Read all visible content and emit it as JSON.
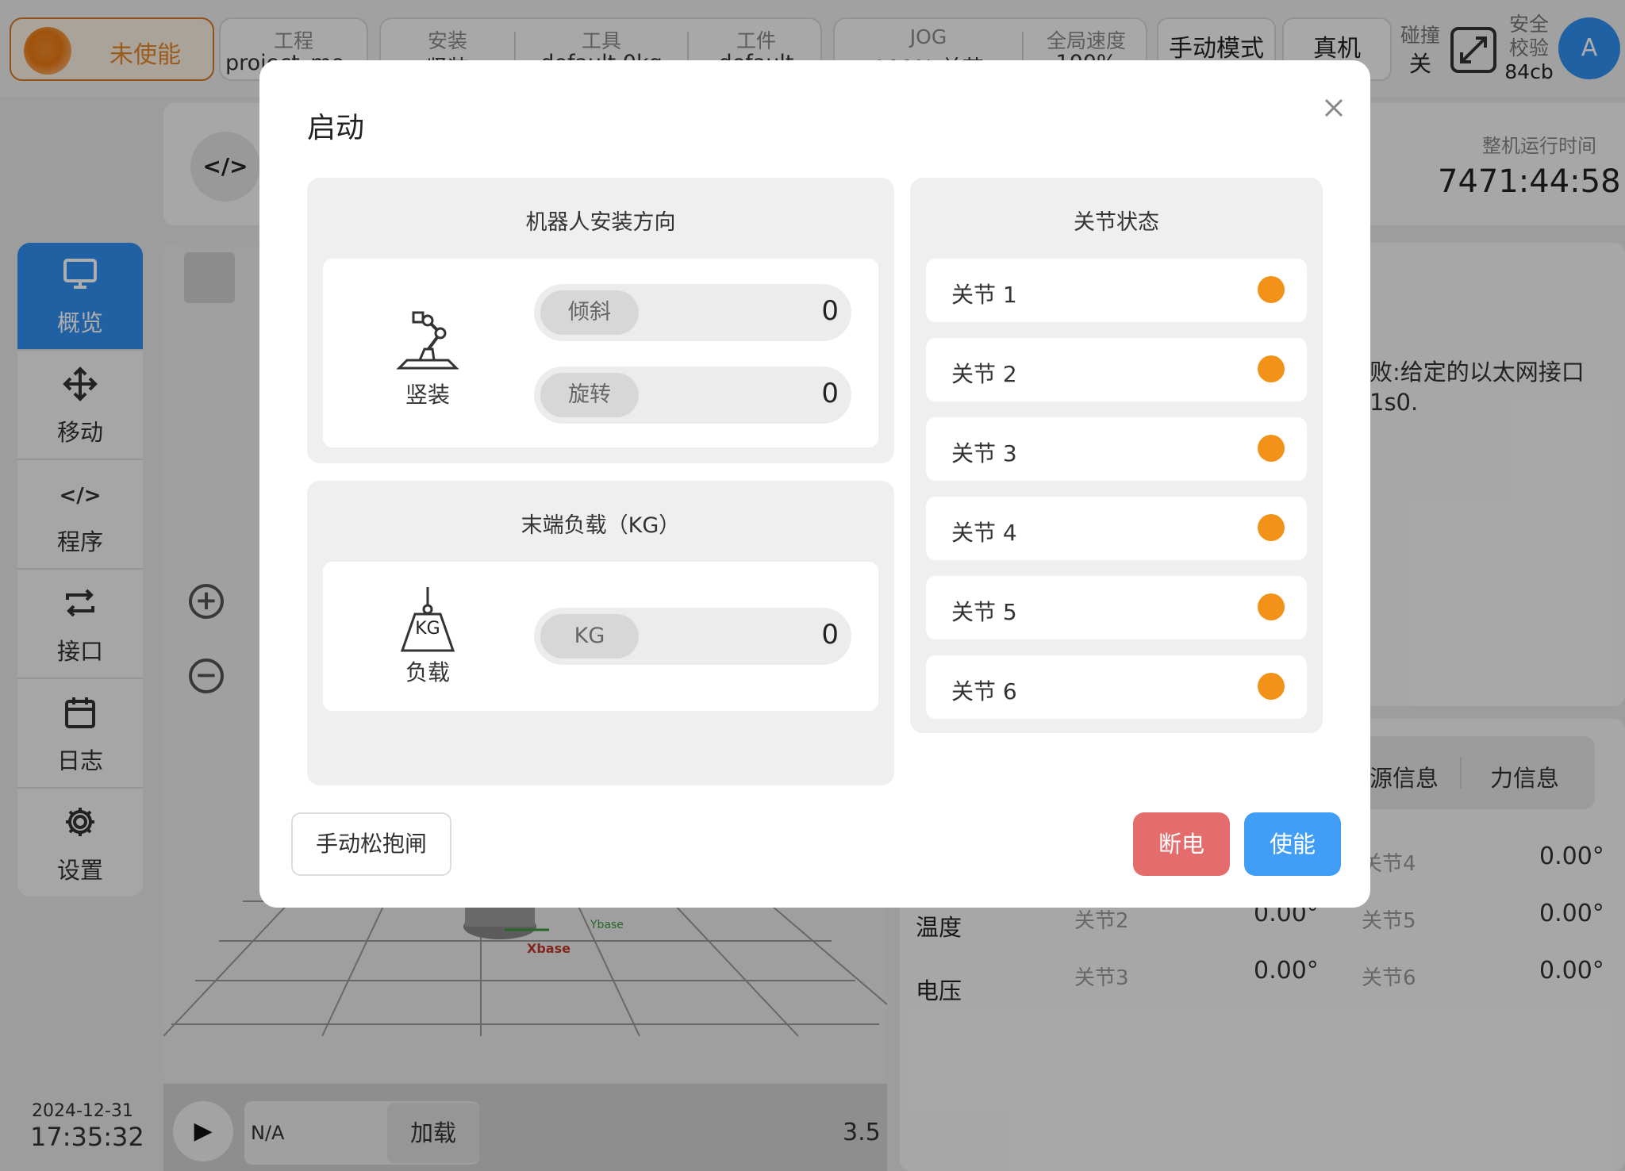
{
  "topbar": {
    "enable_status": "未使能",
    "project_caption": "工程",
    "project_value": "project_mo",
    "install_caption": "安装",
    "install_value": "竖装",
    "tool_caption": "工具",
    "tool_value": "default 0kg",
    "workpiece_caption": "工件",
    "workpiece_value": "default",
    "jog_caption": "JOG",
    "jog_value": "100% 关节",
    "global_speed_caption": "全局速度",
    "global_speed_value": "100%",
    "mode_button": "手动模式",
    "real_machine_button": "真机",
    "collision_caption": "碰撞",
    "collision_value": "关",
    "safety_caption_1": "安全",
    "safety_caption_2": "校验",
    "safety_value": "84cb",
    "avatar_letter": "A"
  },
  "sidebar": {
    "items": [
      {
        "label": "概览",
        "icon": "monitor-icon"
      },
      {
        "label": "移动",
        "icon": "move-arrows-icon"
      },
      {
        "label": "程序",
        "icon": "code-icon"
      },
      {
        "label": "接口",
        "icon": "swap-arrows-icon"
      },
      {
        "label": "日志",
        "icon": "calendar-icon"
      },
      {
        "label": "设置",
        "icon": "gear-icon"
      }
    ],
    "date": "2024-12-31",
    "time": "17:35:32"
  },
  "main": {
    "code_label": "</>",
    "runtime_caption": "整机运行时间",
    "runtime_value": "7471:44:58",
    "error_line1": "败:给定的以太网接口",
    "error_line2": "1s0.",
    "tab_source": "源信息",
    "tab_force": "力信息",
    "row_temperature": "温度",
    "row_voltage": "电压",
    "joints": [
      {
        "label": "关节2",
        "value": "0.00°"
      },
      {
        "label": "关节3",
        "value": "0.00°"
      },
      {
        "label": "关节4",
        "value": "0.00°"
      },
      {
        "label": "关节5",
        "value": "0.00°"
      },
      {
        "label": "关节6",
        "value": "0.00°"
      }
    ],
    "program_name": "N/A",
    "load_button": "加载",
    "speed_value": "3.5",
    "axis_x": "Xbase",
    "axis_y": "Ybase"
  },
  "modal": {
    "title": "启动",
    "mount_section_title": "机器人安装方向",
    "mount_type_label": "竖装",
    "tilt_label": "倾斜",
    "tilt_value": "0",
    "rotate_label": "旋转",
    "rotate_value": "0",
    "payload_section_title": "末端负载（KG）",
    "payload_icon_text": "KG",
    "payload_label": "负载",
    "payload_unit": "KG",
    "payload_value": "0",
    "joint_section_title": "关节状态",
    "joints": [
      {
        "label": "关节 1",
        "status_color": "#f39219"
      },
      {
        "label": "关节 2",
        "status_color": "#f39219"
      },
      {
        "label": "关节 3",
        "status_color": "#f39219"
      },
      {
        "label": "关节 4",
        "status_color": "#f39219"
      },
      {
        "label": "关节 5",
        "status_color": "#f39219"
      },
      {
        "label": "关节 6",
        "status_color": "#f39219"
      }
    ],
    "release_brake_button": "手动松抱闸",
    "power_off_button": "断电",
    "enable_button": "使能"
  },
  "colors": {
    "accent_blue": "#409ef6",
    "danger_red": "#e46c6c",
    "status_orange": "#f39219"
  }
}
